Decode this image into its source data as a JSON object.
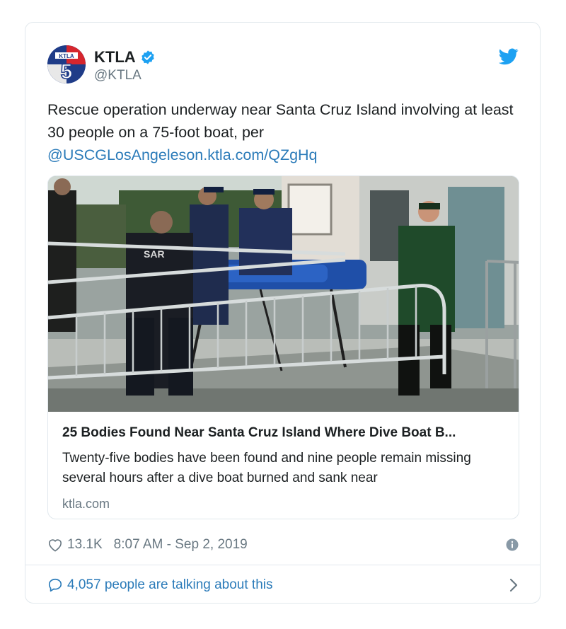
{
  "account": {
    "name": "KTLA",
    "handle": "@KTLA",
    "avatar_text": "KTLA 5"
  },
  "tweet": {
    "text": "Rescue operation underway near Santa Cruz Island involving at least 30 people on a 75-foot boat, per ",
    "mention": "@USCGLosAngeles",
    "link": "on.ktla.com/QZgHq"
  },
  "link_card": {
    "title": "25 Bodies Found Near Santa Cruz Island Where Dive Boat B...",
    "description": "Twenty-five bodies have been found and nine people remain missing several hours after a dive boat burned and sank near",
    "domain": "ktla.com",
    "image_alt": "Rescuers wheeling a gurney down a boat ramp",
    "jacket_text": "SAR"
  },
  "meta": {
    "likes": "13.1K",
    "timestamp": "8:07 AM - Sep 2, 2019"
  },
  "footer": {
    "conversation": "4,057 people are talking about this"
  },
  "colors": {
    "link": "#2b7bb9",
    "verified": "#1da1f2",
    "muted": "#697882",
    "border": "#e1e8ed"
  }
}
